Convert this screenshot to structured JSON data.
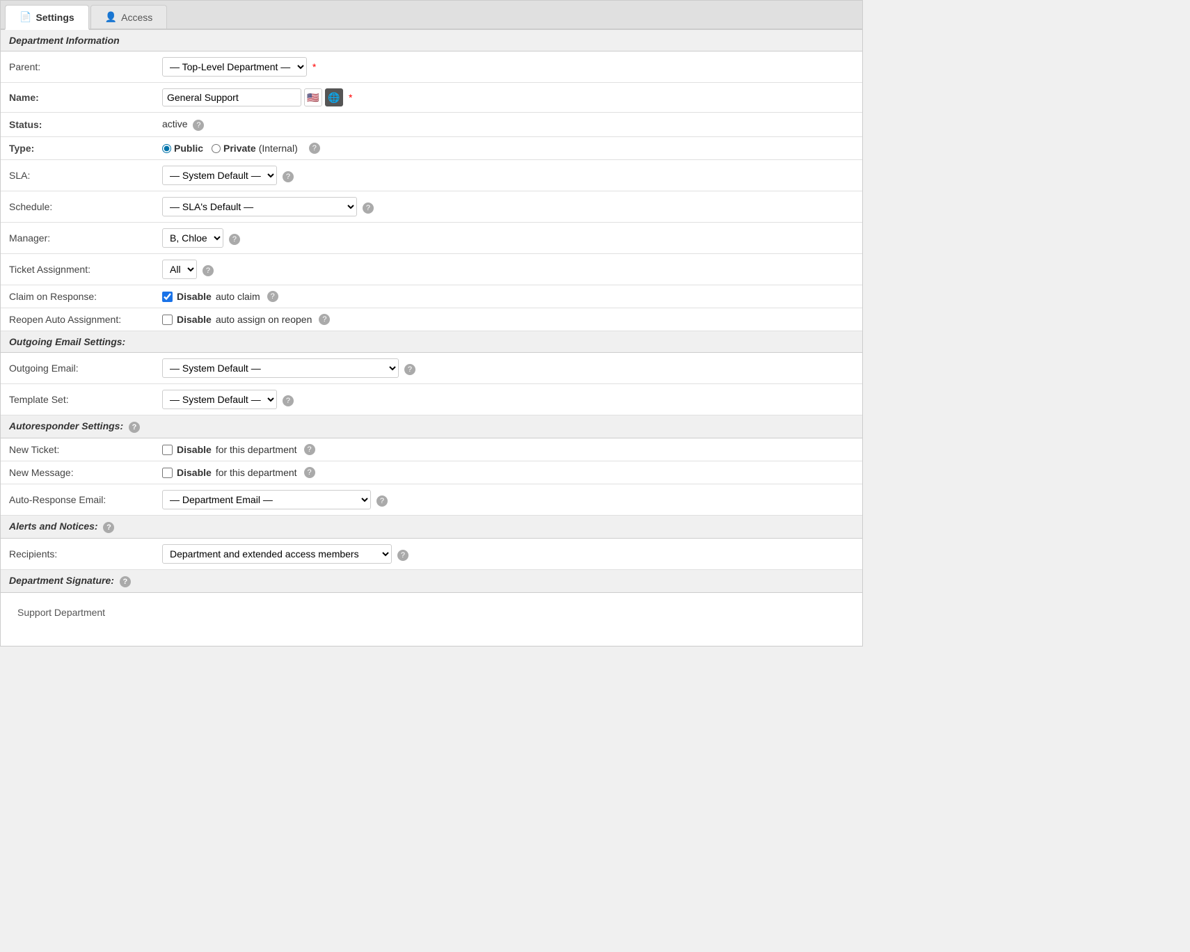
{
  "tabs": [
    {
      "id": "settings",
      "label": "Settings",
      "icon": "file-icon",
      "active": true
    },
    {
      "id": "access",
      "label": "Access",
      "icon": "person-icon",
      "active": false
    }
  ],
  "sections": {
    "departmentInfo": {
      "title": "Department Information",
      "fields": {
        "parent": {
          "label": "Parent:",
          "value": "— Top-Level Department —",
          "required": true,
          "options": [
            "— Top-Level Department —"
          ]
        },
        "name": {
          "label": "Name:",
          "value": "General Support",
          "required": true,
          "bold": true
        },
        "status": {
          "label": "Status:",
          "value": "active",
          "bold": true,
          "hasHelp": true
        },
        "type": {
          "label": "Type:",
          "bold": true,
          "options": [
            {
              "value": "public",
              "label": "Public",
              "checked": true
            },
            {
              "value": "private",
              "label": "Private (Internal)",
              "checked": false
            }
          ],
          "hasHelp": true
        },
        "sla": {
          "label": "SLA:",
          "value": "— System Default —",
          "hasHelp": true,
          "options": [
            "— System Default —"
          ]
        },
        "schedule": {
          "label": "Schedule:",
          "value": "— SLA's Default —",
          "hasHelp": true,
          "options": [
            "— SLA's Default —"
          ]
        },
        "manager": {
          "label": "Manager:",
          "value": "B, Chloe",
          "hasHelp": true,
          "options": [
            "B, Chloe"
          ]
        },
        "ticketAssignment": {
          "label": "Ticket Assignment:",
          "value": "All",
          "hasHelp": true,
          "options": [
            "All"
          ]
        },
        "claimOnResponse": {
          "label": "Claim on Response:",
          "checkLabel": "Disable",
          "checkLabel2": "auto claim",
          "checked": true,
          "hasHelp": true
        },
        "reopenAutoAssignment": {
          "label": "Reopen Auto Assignment:",
          "checkLabel": "Disable",
          "checkLabel2": "auto assign on reopen",
          "checked": false,
          "hasHelp": true
        }
      }
    },
    "outgoingEmail": {
      "title": "Outgoing Email Settings:",
      "fields": {
        "outgoingEmail": {
          "label": "Outgoing Email:",
          "value": "— System Default —",
          "hasHelp": true,
          "options": [
            "— System Default —"
          ]
        },
        "templateSet": {
          "label": "Template Set:",
          "value": "— System Default —",
          "hasHelp": true,
          "options": [
            "— System Default —"
          ]
        }
      }
    },
    "autoresponder": {
      "title": "Autoresponder Settings:",
      "hasHelp": true,
      "fields": {
        "newTicket": {
          "label": "New Ticket:",
          "checkLabel": "Disable",
          "checkLabel2": "for this department",
          "checked": false,
          "hasHelp": true
        },
        "newMessage": {
          "label": "New Message:",
          "checkLabel": "Disable",
          "checkLabel2": "for this department",
          "checked": false,
          "hasHelp": true
        },
        "autoResponseEmail": {
          "label": "Auto-Response Email:",
          "value": "— Department Email —",
          "hasHelp": true,
          "options": [
            "— Department Email —"
          ]
        }
      }
    },
    "alertsAndNotices": {
      "title": "Alerts and Notices:",
      "hasHelp": true,
      "fields": {
        "recipients": {
          "label": "Recipients:",
          "value": "Department and extended access members",
          "hasHelp": true,
          "options": [
            "Department and extended access members"
          ]
        }
      }
    },
    "departmentSignature": {
      "title": "Department Signature:",
      "hasHelp": true,
      "signatureText": "Support Department"
    }
  },
  "icons": {
    "file": "📄",
    "person": "👤",
    "help": "?",
    "flag": "🇺🇸",
    "globe": "🌐"
  }
}
